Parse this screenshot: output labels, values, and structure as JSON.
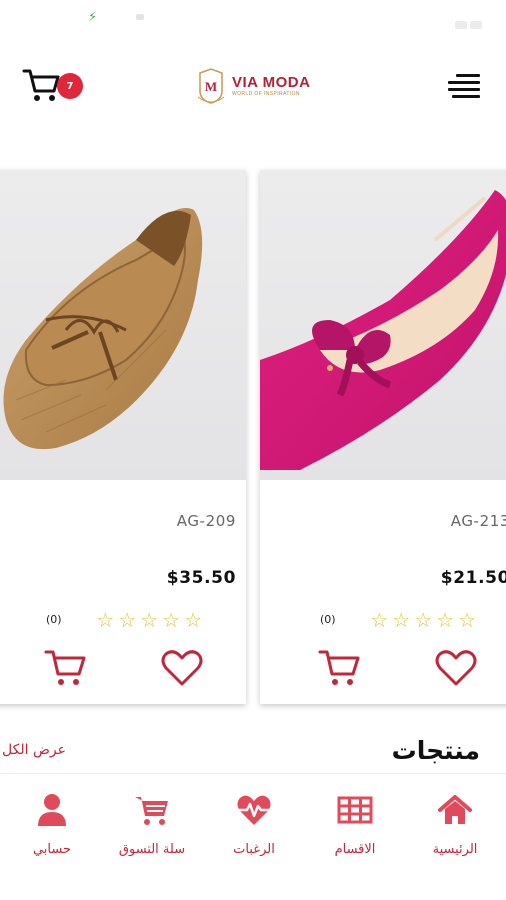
{
  "header": {
    "brand": "VIA MODA",
    "tagline": "WORLD OF INSPIRATION",
    "cart_count": "7"
  },
  "products": [
    {
      "sku": "AG-213",
      "price": "$21.50",
      "rating": 5,
      "review_count": "(0)",
      "image": "pink suede pointed flat with bow"
    },
    {
      "sku": "AG-209",
      "price": "$35.50",
      "rating": 5,
      "review_count": "(0)",
      "image": "tan croc-embossed loafer with bow"
    }
  ],
  "section": {
    "title": "منتجات",
    "view_all": "عرض الكل"
  },
  "bottom_nav": [
    {
      "label": "الرئيسية",
      "icon": "home-icon"
    },
    {
      "label": "الاقسام",
      "icon": "grid-icon"
    },
    {
      "label": "الرغبات",
      "icon": "heart-pulse-icon"
    },
    {
      "label": "سلة التسوق",
      "icon": "cart-icon"
    },
    {
      "label": "حسابي",
      "icon": "user-icon"
    }
  ],
  "colors": {
    "accent": "#c0273a",
    "badge": "#e0263a",
    "star": "#e8c230"
  }
}
